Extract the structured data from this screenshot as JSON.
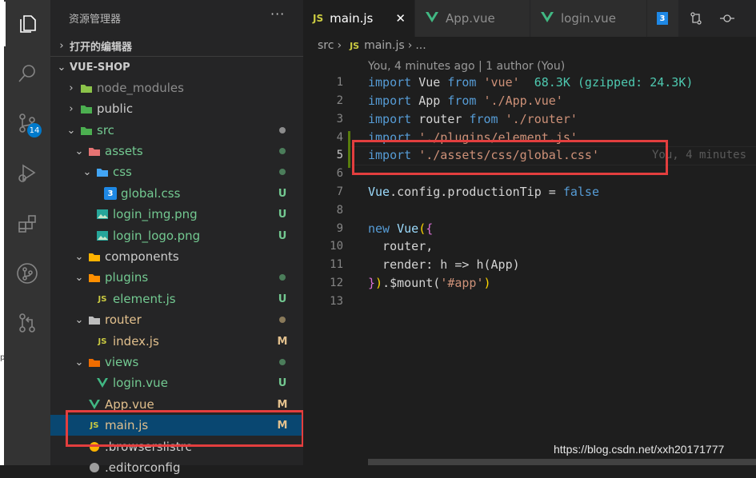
{
  "left_strip": {
    "stray_text": "p"
  },
  "activity_bar": {
    "items": [
      {
        "icon": "files-icon",
        "active": true
      },
      {
        "icon": "search-icon"
      },
      {
        "icon": "source-control-icon",
        "badge": "14"
      },
      {
        "icon": "run-debug-icon"
      },
      {
        "icon": "extensions-icon"
      },
      {
        "icon": "git-graph-icon"
      },
      {
        "icon": "pull-request-icon"
      }
    ]
  },
  "sidebar": {
    "title": "资源管理器",
    "more": "···",
    "open_editors": "打开的编辑器",
    "project": "VUE-SHOP",
    "tree": [
      {
        "name": "node_modules",
        "status": "",
        "color": "#8c8c8c"
      },
      {
        "name": "public",
        "status": "",
        "color": "#cccccc"
      },
      {
        "name": "src",
        "status": "dot",
        "color": "#73c991"
      },
      {
        "name": "assets",
        "status": "dot",
        "color": "#73c991"
      },
      {
        "name": "css",
        "status": "dot",
        "color": "#73c991"
      },
      {
        "name": "global.css",
        "status": "U",
        "color": "#73c991"
      },
      {
        "name": "login_img.png",
        "status": "U",
        "color": "#73c991"
      },
      {
        "name": "login_logo.png",
        "status": "U",
        "color": "#73c991"
      },
      {
        "name": "components",
        "status": "",
        "color": "#cccccc"
      },
      {
        "name": "plugins",
        "status": "dot",
        "color": "#73c991"
      },
      {
        "name": "element.js",
        "status": "U",
        "color": "#73c991"
      },
      {
        "name": "router",
        "status": "dot",
        "color": "#e2c08d"
      },
      {
        "name": "index.js",
        "status": "M",
        "color": "#e2c08d"
      },
      {
        "name": "views",
        "status": "dot",
        "color": "#73c991"
      },
      {
        "name": "login.vue",
        "status": "U",
        "color": "#73c991"
      },
      {
        "name": "App.vue",
        "status": "M",
        "color": "#e2c08d"
      },
      {
        "name": "main.js",
        "status": "M",
        "color": "#e2c08d"
      },
      {
        "name": ".browserslistrc",
        "status": "",
        "color": "#cccccc"
      },
      {
        "name": ".editorconfig",
        "status": "",
        "color": "#cccccc"
      }
    ]
  },
  "tabs": [
    {
      "label": "main.js",
      "type": "JS",
      "active": true
    },
    {
      "label": "App.vue",
      "type": "vue"
    },
    {
      "label": "login.vue",
      "type": "vue"
    }
  ],
  "breadcrumb": {
    "folder": "src",
    "file_type": "JS",
    "file": "main.js",
    "tail": "..."
  },
  "blame": "You, 4 minutes ago | 1 author (You)",
  "inline_blame": "You, 4 minutes",
  "line_numbers": [
    "1",
    "2",
    "3",
    "4",
    "5",
    "6",
    "7",
    "8",
    "9",
    "10",
    "11",
    "12",
    "13"
  ],
  "code": {
    "l1": {
      "kw1": "import",
      "name": " Vue ",
      "kw2": "from",
      "str": " 'vue'",
      "size": "  68.3K (gzipped: 24.3K)"
    },
    "l2": {
      "kw1": "import",
      "name": " App ",
      "kw2": "from",
      "str": " './App.vue'"
    },
    "l3": {
      "kw1": "import",
      "name": " router ",
      "kw2": "from",
      "str": " './router'"
    },
    "l4": {
      "kw1": "import",
      "str": " './plugins/element.js'"
    },
    "l5": {
      "kw1": "import",
      "str": " './assets/css/global.css'"
    },
    "l7": {
      "obj": "Vue",
      "rest": ".config.productionTip = ",
      "val": "false"
    },
    "l9": {
      "kw": "new",
      "cls": " Vue",
      "open": "(",
      "brace": "{"
    },
    "l10": {
      "text": "  router,"
    },
    "l11": {
      "text": "  render: h => h(App)"
    },
    "l12": {
      "brace": "}",
      "close": ")",
      "rest": ".$mount(",
      "str": "'#app'",
      "end": ")"
    }
  },
  "watermark": "https://blog.csdn.net/xxh20171777"
}
